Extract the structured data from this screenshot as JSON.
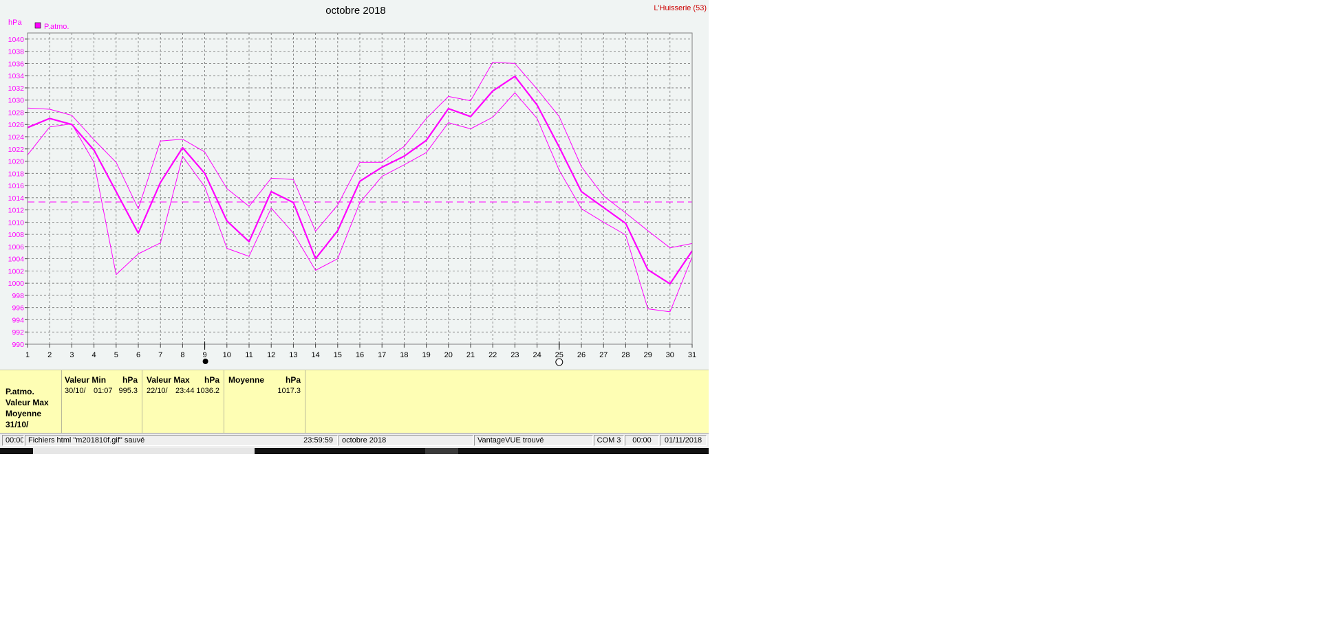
{
  "header": {
    "title": "octobre 2018",
    "station": "L'Huisserie (53)",
    "unit": "hPa"
  },
  "legend": {
    "label": "P.atmo."
  },
  "chart_data": {
    "type": "line",
    "title": "octobre 2018",
    "ylabel": "hPa",
    "xlabel": "",
    "x": [
      1,
      2,
      3,
      4,
      5,
      6,
      7,
      8,
      9,
      10,
      11,
      12,
      13,
      14,
      15,
      16,
      17,
      18,
      19,
      20,
      21,
      22,
      23,
      24,
      25,
      26,
      27,
      28,
      29,
      30,
      31
    ],
    "xlim": [
      1,
      31
    ],
    "ylim": [
      990,
      1041
    ],
    "yticks": [
      990,
      992,
      994,
      996,
      998,
      1000,
      1002,
      1004,
      1006,
      1008,
      1010,
      1012,
      1014,
      1016,
      1018,
      1020,
      1022,
      1024,
      1026,
      1028,
      1030,
      1032,
      1034,
      1036,
      1038,
      1040
    ],
    "grid": true,
    "legend_position": "top-left",
    "series": [
      {
        "name": "P.atmo.",
        "role": "mean",
        "color": "#ff00ff",
        "values": [
          1025.5,
          1027.0,
          1026.0,
          1021.8,
          1015.0,
          1008.2,
          1016.5,
          1022.2,
          1018.0,
          1010.2,
          1006.8,
          1015.0,
          1013.2,
          1004.0,
          1008.6,
          1016.7,
          1019.0,
          1020.8,
          1023.4,
          1028.6,
          1027.3,
          1031.5,
          1033.9,
          1029.2,
          1022.3,
          1015.0,
          1012.4,
          1009.8,
          1002.2,
          999.9,
          1005.3
        ]
      },
      {
        "role": "max",
        "color": "#ff00ff",
        "values": [
          1028.7,
          1028.5,
          1027.5,
          1023.5,
          1019.8,
          1012.2,
          1023.3,
          1023.6,
          1021.5,
          1015.5,
          1012.6,
          1017.2,
          1017.0,
          1008.5,
          1012.8,
          1019.8,
          1019.8,
          1022.4,
          1027.0,
          1030.6,
          1029.9,
          1036.2,
          1036.0,
          1031.8,
          1027.3,
          1019.1,
          1014.3,
          1011.5,
          1008.6,
          1005.8,
          1006.5
        ]
      },
      {
        "role": "min",
        "color": "#ff00ff",
        "values": [
          1021.0,
          1025.6,
          1026.1,
          1019.8,
          1001.4,
          1004.8,
          1006.6,
          1020.8,
          1015.8,
          1005.7,
          1004.4,
          1012.3,
          1008.2,
          1002.1,
          1004.0,
          1013.2,
          1017.5,
          1019.4,
          1021.4,
          1026.3,
          1025.3,
          1027.2,
          1031.2,
          1027.0,
          1018.5,
          1012.2,
          1010.0,
          1007.9,
          995.8,
          995.3,
          1004.3
        ]
      }
    ],
    "reference_line": {
      "value": 1013.3,
      "style": "dashed",
      "color": "#ff00ff"
    },
    "moon_markers": [
      {
        "day": 9,
        "phase": "new"
      },
      {
        "day": 25,
        "phase": "full"
      }
    ]
  },
  "summary": {
    "row_labels": [
      "P.atmo.",
      "Valeur Max",
      "Moyenne",
      "31/10/"
    ],
    "min": {
      "header": "Valeur Min",
      "unit": "hPa",
      "date": "30/10/",
      "time": "01:07",
      "value": "995.3"
    },
    "max": {
      "header": "Valeur Max",
      "unit": "hPa",
      "date": "22/10/",
      "time": "23:44",
      "value": "1036.2"
    },
    "avg": {
      "header": "Moyenne",
      "unit": "hPa",
      "value": "1017.3"
    }
  },
  "status": {
    "time": "00:00",
    "message": "Fichiers html  \"m201810f.gif\"  sauvé",
    "clock": "23:59:59",
    "period": "octobre 2018",
    "device": "VantageVUE trouvé",
    "port": "COM 3",
    "time2": "00:00",
    "date": "01/11/2018"
  },
  "colors": {
    "series": "#ff00ff",
    "title": "#000000",
    "station": "#cc0000",
    "plot_bg": "#f0f4f3",
    "info_bg": "#fefeb4"
  }
}
